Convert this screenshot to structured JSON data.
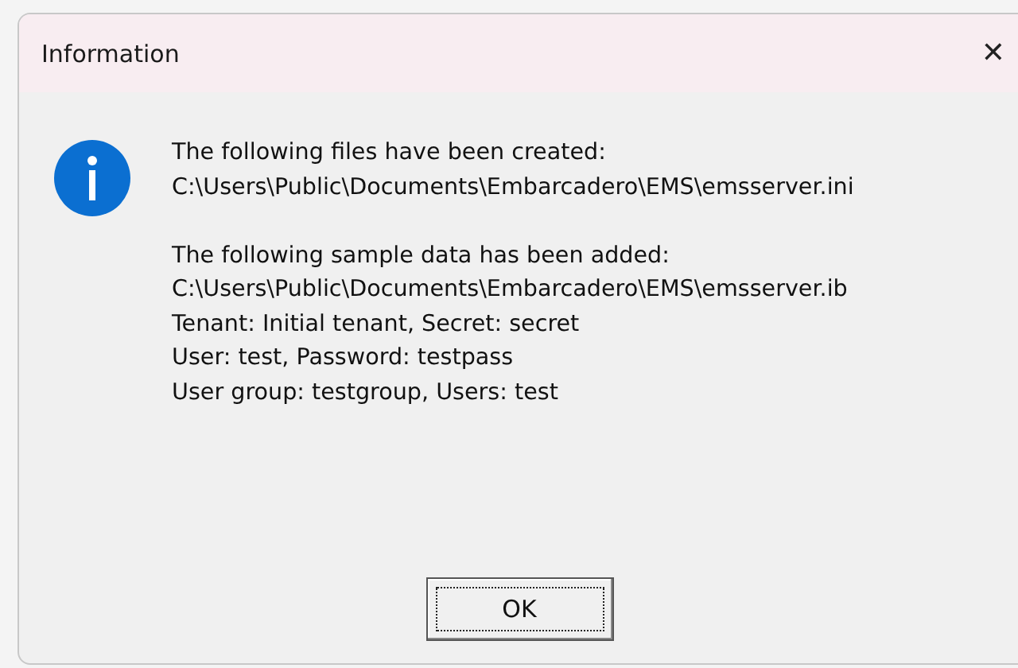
{
  "window": {
    "title": "Information",
    "close": "✕"
  },
  "message": {
    "paragraphs": [
      [
        "The following files have been created:",
        "C:\\Users\\Public\\Documents\\Embarcadero\\EMS\\emsserver.ini"
      ],
      [
        "The following sample data has been added:",
        "C:\\Users\\Public\\Documents\\Embarcadero\\EMS\\emsserver.ib",
        "Tenant: Initial tenant, Secret: secret",
        "User: test, Password: testpass",
        "User group: testgroup, Users: test"
      ]
    ]
  },
  "buttons": [
    {
      "label": "OK",
      "focused": true
    }
  ]
}
